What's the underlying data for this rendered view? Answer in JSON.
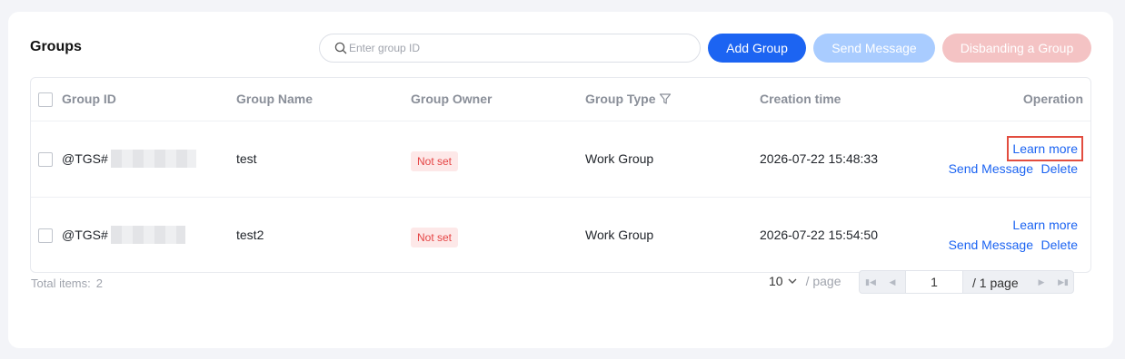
{
  "header": {
    "title": "Groups",
    "search_placeholder": "Enter group ID",
    "add_label": "Add Group",
    "send_label": "Send Message",
    "disband_label": "Disbanding a Group"
  },
  "table": {
    "columns": [
      "Group ID",
      "Group Name",
      "Group Owner",
      "Group Type",
      "Creation time",
      "Operation"
    ],
    "rows": [
      {
        "id": "@TGS#",
        "name": "test",
        "owner": "Not set",
        "type": "Work Group",
        "created": "2026-07-22 15:48:33"
      },
      {
        "id": "@TGS#",
        "name": "test2",
        "owner": "Not set",
        "type": "Work Group",
        "created": "2026-07-22 15:54:50"
      }
    ],
    "actions": {
      "learn": "Learn more",
      "send": "Send Message",
      "delete": "Delete"
    }
  },
  "footer": {
    "total_label": "Total items:",
    "total_value": "2",
    "page_size": "10",
    "page_size_suffix": "/ page",
    "current_page": "1",
    "total_pages": "/ 1 page"
  },
  "colors": {
    "primary": "#1c64f2",
    "danger_tag": "#e54545",
    "highlight": "#e24d3f"
  }
}
